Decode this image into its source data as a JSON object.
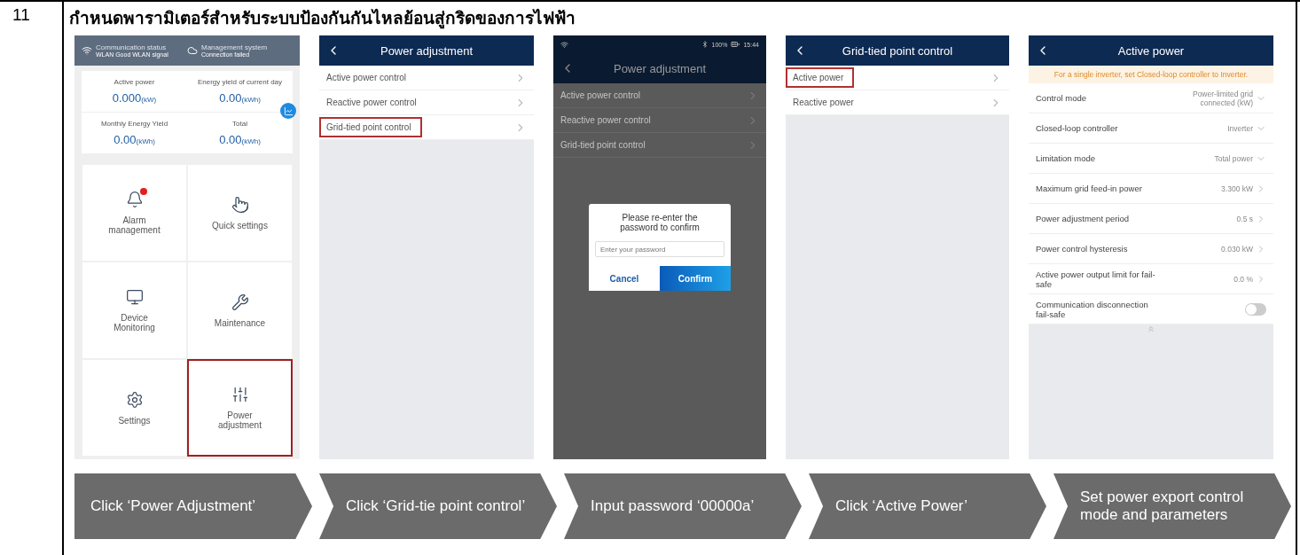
{
  "row_number": "11",
  "title": "กำหนดพารามิเตอร์สำหรับระบบป้องกันกันไหลย้อนสู่กริดของการไฟฟ้า",
  "screens": [
    {
      "kind": "home",
      "status": [
        {
          "label": "Communication status",
          "value": "WLAN Good WLAN signal"
        },
        {
          "label": "Management system",
          "value": "Connection failed"
        }
      ],
      "stats": [
        {
          "label": "Active power",
          "value": "0.000",
          "unit": "(kW)"
        },
        {
          "label": "Energy yield of current day",
          "value": "0.00",
          "unit": "(kWh)"
        },
        {
          "label": "Monthly Energy Yield",
          "value": "0.00",
          "unit": "(kWh)"
        },
        {
          "label": "Total",
          "value": "0.00",
          "unit": "(kWh)"
        }
      ],
      "tiles": [
        {
          "label": "Alarm management",
          "selected": false,
          "alert": true
        },
        {
          "label": "Quick settings",
          "selected": false,
          "alert": false
        },
        {
          "label": "Device Monitoring",
          "selected": false,
          "alert": false
        },
        {
          "label": "Maintenance",
          "selected": false,
          "alert": false
        },
        {
          "label": "Settings",
          "selected": false,
          "alert": false
        },
        {
          "label": "Power adjustment",
          "selected": true,
          "alert": false
        }
      ]
    },
    {
      "kind": "menu",
      "title": "Power adjustment",
      "items": [
        {
          "label": "Active power control",
          "selected": false
        },
        {
          "label": "Reactive power control",
          "selected": false
        },
        {
          "label": "Grid-tied point control",
          "selected": true
        }
      ]
    },
    {
      "kind": "dialog",
      "battery": "100%",
      "time": "15:44",
      "title": "Power adjustment",
      "items": [
        {
          "label": "Active power control"
        },
        {
          "label": "Reactive power control"
        },
        {
          "label": "Grid-tied point control"
        }
      ],
      "dialog": {
        "message": "Please re-enter the password to confirm",
        "placeholder": "Enter your password",
        "buttons": [
          {
            "label": "Cancel",
            "primary": false
          },
          {
            "label": "Confirm",
            "primary": true
          }
        ]
      }
    },
    {
      "kind": "menu",
      "title": "Grid-tied point control",
      "items": [
        {
          "label": "Active power",
          "selected": true
        },
        {
          "label": "Reactive power",
          "selected": false
        }
      ]
    },
    {
      "kind": "settings",
      "title": "Active power",
      "notice": "For a single inverter, set Closed-loop controller to Inverter.",
      "rows": [
        {
          "kind": "select",
          "label": "Control mode",
          "value": "Power-limited grid connected  (kW)"
        },
        {
          "kind": "select",
          "label": "Closed-loop controller",
          "value": "Inverter"
        },
        {
          "kind": "select",
          "label": "Limitation mode",
          "value": "Total power"
        },
        {
          "kind": "link",
          "label": "Maximum grid feed-in power",
          "value": "3.300 kW"
        },
        {
          "kind": "link",
          "label": "Power adjustment period",
          "value": "0.5 s"
        },
        {
          "kind": "link",
          "label": "Power control hysteresis",
          "value": "0.030 kW"
        },
        {
          "kind": "link",
          "label": "Active power output limit for fail-safe",
          "value": "0.0 %"
        },
        {
          "kind": "toggle",
          "label": "Communication disconnection fail-safe",
          "on": false
        }
      ]
    }
  ],
  "steps": [
    "Click ‘Power Adjustment’",
    "Click ‘Grid-tie point control’",
    "Input password ‘00000a’",
    "Click ‘Active Power’",
    "Set power export control mode and parameters"
  ]
}
